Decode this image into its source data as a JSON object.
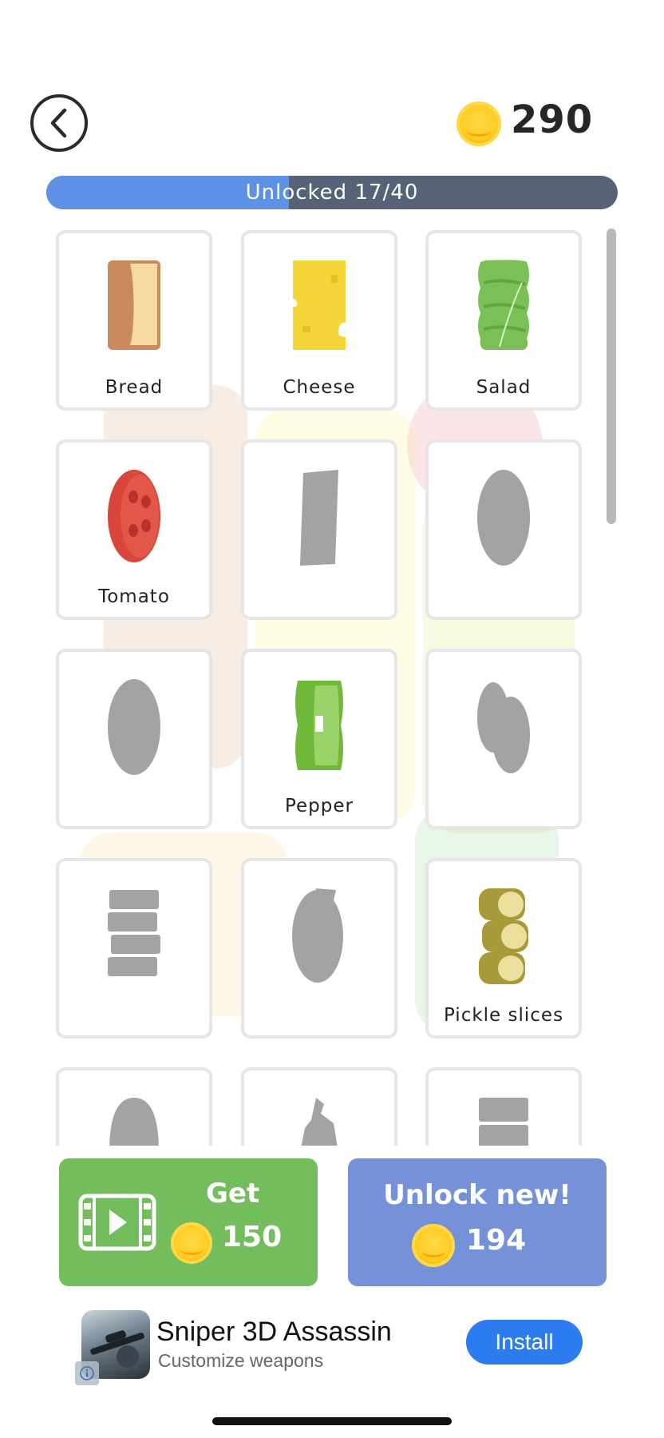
{
  "header": {
    "back_icon": "chevron-left-icon",
    "coin_count": "290"
  },
  "progress": {
    "label": "Unlocked 17/40",
    "unlocked": 17,
    "total": 40,
    "fill_color": "#5e90e6",
    "track_color": "#566278"
  },
  "ingredients": [
    {
      "label": "Bread",
      "unlocked": true,
      "icon": "bread-slice-icon"
    },
    {
      "label": "Cheese",
      "unlocked": true,
      "icon": "cheese-slice-icon"
    },
    {
      "label": "Salad",
      "unlocked": true,
      "icon": "lettuce-icon"
    },
    {
      "label": "Tomato",
      "unlocked": true,
      "icon": "tomato-slice-icon"
    },
    {
      "label": "",
      "unlocked": false,
      "icon": "locked-strip-silhouette-icon"
    },
    {
      "label": "",
      "unlocked": false,
      "icon": "locked-oval-silhouette-icon"
    },
    {
      "label": "",
      "unlocked": false,
      "icon": "locked-oval-silhouette-icon"
    },
    {
      "label": "Pepper",
      "unlocked": true,
      "icon": "pepper-ring-icon"
    },
    {
      "label": "",
      "unlocked": false,
      "icon": "locked-double-slice-silhouette-icon"
    },
    {
      "label": "",
      "unlocked": false,
      "icon": "locked-stacked-strips-silhouette-icon"
    },
    {
      "label": "",
      "unlocked": false,
      "icon": "locked-round-slice-silhouette-icon"
    },
    {
      "label": "Pickle slices",
      "unlocked": true,
      "icon": "pickle-slices-icon"
    },
    {
      "label": "",
      "unlocked": false,
      "icon": "locked-dome-silhouette-icon"
    },
    {
      "label": "",
      "unlocked": false,
      "icon": "locked-figure-silhouette-icon"
    },
    {
      "label": "",
      "unlocked": false,
      "icon": "locked-block-silhouette-icon"
    }
  ],
  "buttons": {
    "get": {
      "title": "Get",
      "amount": "150",
      "icon": "video-play-icon"
    },
    "unlock": {
      "title": "Unlock new!",
      "amount": "194"
    }
  },
  "ad": {
    "title": "Sniper 3D Assassin",
    "subtitle": "Customize weapons",
    "install_label": "Install",
    "icon": "sniper-rifle-icon"
  },
  "colors": {
    "get_button": "#74bd5c",
    "unlock_button": "#7592d9",
    "install_button": "#2c7cf0",
    "coin": "#ffcc22"
  }
}
